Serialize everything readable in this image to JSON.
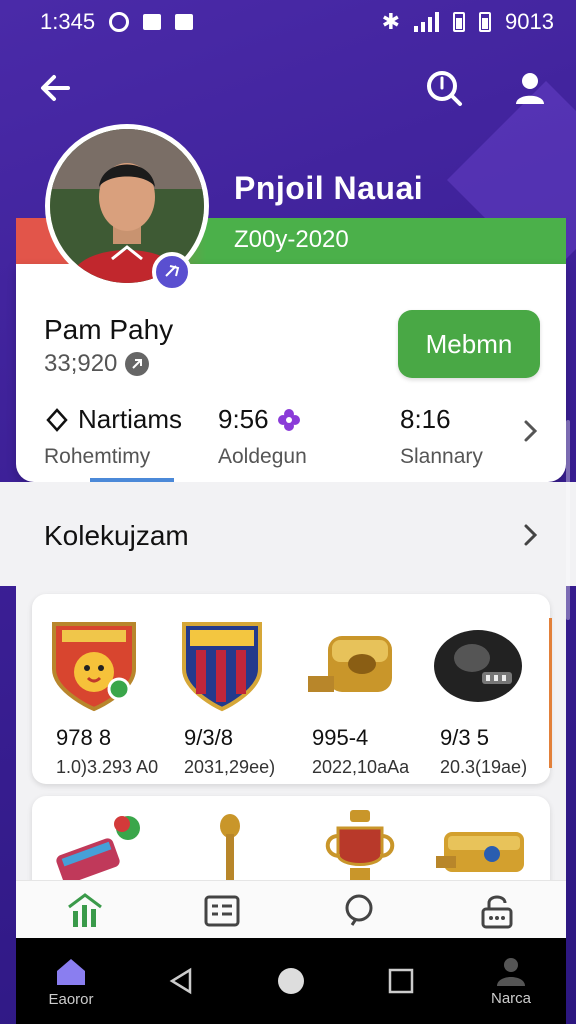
{
  "status_bar": {
    "time": "1:345",
    "right_text": "9013"
  },
  "hero": {
    "title": "Pnjoil Nauai",
    "years": "Z00y-2020"
  },
  "profile": {
    "name": "Pam Pahy",
    "id": "33;920",
    "member_label": "Mebmn",
    "stats": [
      {
        "value": "Nartiams",
        "label": "Rohemtimy"
      },
      {
        "value": "9:56",
        "label": "Aoldegun"
      },
      {
        "value": "8:16",
        "label": "Slannary"
      }
    ]
  },
  "collection": {
    "title": "Kolekujzam",
    "items": [
      {
        "value": "978 8",
        "sub": "1.0)3.293 A0",
        "icon": "red-club-crest-icon"
      },
      {
        "value": "9/3/8",
        "sub": "2031,29ee)",
        "icon": "blue-red-club-crest-icon"
      },
      {
        "value": "995-4",
        "sub": "2022,10aAa",
        "icon": "gold-whistle-icon"
      },
      {
        "value": "9/3 5",
        "sub": "20.3(19ae)",
        "icon": "black-device-icon"
      }
    ],
    "items_row2": [
      {
        "icon": "keyboard-toy-icon"
      },
      {
        "icon": "gold-torch-icon"
      },
      {
        "icon": "trophy-cup-icon"
      },
      {
        "icon": "gold-block-icon"
      }
    ]
  },
  "bottom_tabs": [
    {
      "icon": "home-stats-icon"
    },
    {
      "icon": "list-card-icon"
    },
    {
      "icon": "search-icon"
    },
    {
      "icon": "lock-icon"
    }
  ],
  "system_nav": {
    "home_label": "Eaoror",
    "profile_label": "Narca"
  },
  "colors": {
    "accent_purple": "#3b1f95",
    "member_green": "#49a845",
    "band_red": "#e2554a"
  }
}
